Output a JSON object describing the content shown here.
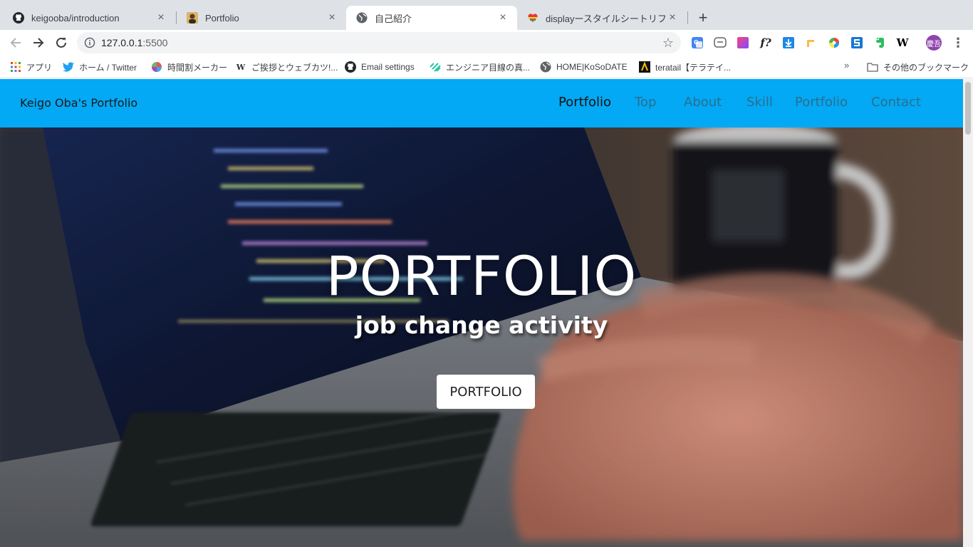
{
  "browser": {
    "tabs": [
      {
        "title": "keigooba/introduction",
        "icon": "github-icon",
        "active": false
      },
      {
        "title": "Portfolio",
        "icon": "avatar-favicon-icon",
        "active": false
      },
      {
        "title": "自己紹介",
        "icon": "globe-icon",
        "active": true
      },
      {
        "title": "displayースタイルシートリファレンス",
        "icon": "heart-icon",
        "active": false
      }
    ],
    "new_tab_label": "+",
    "address": {
      "host": "127.0.0.1",
      "port": ":5500"
    },
    "avatar_label": "慶吾",
    "extensions": [
      "translate-icon",
      "line-icon",
      "gradient-icon",
      "font-f-icon",
      "download-icon",
      "ruler-icon",
      "color-wheel-icon",
      "s-icon",
      "evernote-icon",
      "wikipedia-icon"
    ],
    "bookmarks": [
      {
        "label": "アプリ",
        "icon": "apps-grid-icon"
      },
      {
        "label": "ホーム / Twitter",
        "icon": "twitter-icon"
      },
      {
        "label": "時間割メーカー",
        "icon": "pie-icon"
      },
      {
        "label": "ご挨拶とウェブカツ!...",
        "icon": "w-icon"
      },
      {
        "label": "Email settings",
        "icon": "github-icon"
      },
      {
        "label": "エンジニア目線の真...",
        "icon": "stripe-icon"
      },
      {
        "label": "HOME|KoSoDATE",
        "icon": "globe-icon"
      },
      {
        "label": "teratail【テラテイ...",
        "icon": "teratail-icon"
      }
    ],
    "bookmarks_more": "»",
    "other_bookmarks": "その他のブックマーク"
  },
  "site": {
    "brand": "Keigo Oba's Portfolio",
    "nav": [
      "Portfolio",
      "Top",
      "About",
      "Skill",
      "Portfolio",
      "Contact"
    ],
    "hero": {
      "title": "PORTFOLIO",
      "subtitle": "job change activity",
      "button": "PORTFOLIO"
    }
  },
  "colors": {
    "nav_bg": "#03a9f4",
    "tabstrip_bg": "#dee1e6",
    "avatar_bg": "#8e44ad"
  }
}
